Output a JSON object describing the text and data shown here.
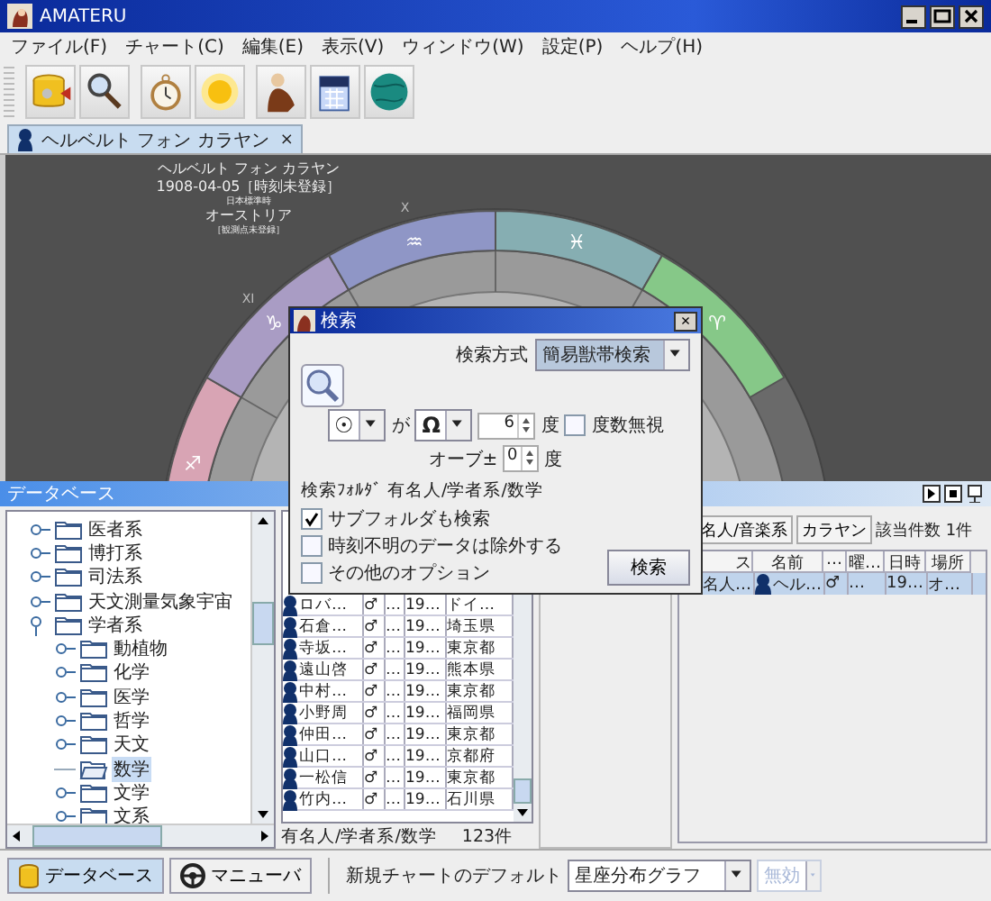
{
  "window": {
    "title": "AMATERU"
  },
  "menu": [
    "ファイル(F)",
    "チャート(C)",
    "編集(E)",
    "表示(V)",
    "ウィンドウ(W)",
    "設定(P)",
    "ヘルプ(H)"
  ],
  "chart_tab": {
    "label": "ヘルベルト フォン カラヤン",
    "close": "×"
  },
  "chart_header": {
    "name": "ヘルベルト フォン カラヤン",
    "date": "1908-04-05［時刻未登録］",
    "timezone": "日本標準時",
    "place": "オーストリア",
    "observation": "［観測点未登録］"
  },
  "wheel_signs": [
    {
      "glyph": "♐",
      "color": "#d8a4b4"
    },
    {
      "glyph": "♑",
      "color": "#a99cc4",
      "house": "XI"
    },
    {
      "glyph": "♒",
      "color": "#8f96c6",
      "house": "X"
    },
    {
      "glyph": "♓",
      "color": "#86aeb2"
    },
    {
      "glyph": "♈",
      "color": "#86c888"
    }
  ],
  "database_panel": {
    "title": "データベース"
  },
  "folder_tree": [
    {
      "label": "医者系",
      "selected": false,
      "expanded": false
    },
    {
      "label": "博打系",
      "selected": false,
      "expanded": false
    },
    {
      "label": "司法系",
      "selected": false,
      "expanded": false
    },
    {
      "label": "天文測量気象宇宙",
      "selected": false,
      "expanded": false
    },
    {
      "label": "学者系",
      "selected": false,
      "expanded": true,
      "children": [
        {
          "label": "動植物",
          "selected": false,
          "expanded": false
        },
        {
          "label": "化学",
          "selected": false,
          "expanded": false
        },
        {
          "label": "医学",
          "selected": false,
          "expanded": false
        },
        {
          "label": "哲学",
          "selected": false,
          "expanded": false
        },
        {
          "label": "天文",
          "selected": false,
          "expanded": false
        },
        {
          "label": "数学",
          "selected": true
        },
        {
          "label": "文学",
          "selected": false,
          "expanded": false
        },
        {
          "label": "文系",
          "selected": false,
          "expanded": false
        }
      ]
    }
  ],
  "person_list": {
    "rows": [
      {
        "name": "ロバ…",
        "sex": "♂",
        "column_3": "…",
        "date": "19…",
        "place": "ドイ…"
      },
      {
        "name": "石倉…",
        "sex": "♂",
        "column_3": "…",
        "date": "19…",
        "place": "埼玉県"
      },
      {
        "name": "寺坂…",
        "sex": "♂",
        "column_3": "…",
        "date": "19…",
        "place": "東京都"
      },
      {
        "name": "遠山啓",
        "sex": "♂",
        "column_3": "…",
        "date": "19…",
        "place": "熊本県"
      },
      {
        "name": "中村…",
        "sex": "♂",
        "column_3": "…",
        "date": "19…",
        "place": "東京都"
      },
      {
        "name": "小野周",
        "sex": "♂",
        "column_3": "…",
        "date": "19…",
        "place": "福岡県"
      },
      {
        "name": "仲田…",
        "sex": "♂",
        "column_3": "…",
        "date": "19…",
        "place": "東京都"
      },
      {
        "name": "山口…",
        "sex": "♂",
        "column_3": "…",
        "date": "19…",
        "place": "京都府"
      },
      {
        "name": "一松信",
        "sex": "♂",
        "column_3": "…",
        "date": "19…",
        "place": "東京都"
      },
      {
        "name": "竹内…",
        "sex": "♂",
        "column_3": "…",
        "date": "19…",
        "place": "石川県"
      }
    ],
    "status_path": "有名人/学者系/数学",
    "status_count": "123件"
  },
  "result_panel": {
    "folder_button": "名人/音楽系",
    "query_button": "カラヤン",
    "count": "該当件数 1件",
    "columns": [
      "ス",
      "名前",
      "…",
      "曜…",
      "日時",
      "場所"
    ],
    "rows": [
      {
        "selected": true,
        "cells": [
          "名人…",
          "ヘル…",
          "♂",
          "…",
          "19…",
          "オ…"
        ]
      }
    ]
  },
  "bottom_bar": {
    "tabs": [
      {
        "label": "データベース",
        "selected": true
      },
      {
        "label": "マニューバ",
        "selected": false
      }
    ],
    "default_label": "新規チャートのデフォルト",
    "default_chart": "星座分布グラフ",
    "extra": {
      "value": "無効",
      "disabled": true
    }
  },
  "search_dialog": {
    "title": "検索",
    "close": "×",
    "method_label": "検索方式",
    "method": "簡易獣帯検索",
    "planet_a": "☉",
    "particle": "が",
    "planet_b": "Ω",
    "degrees": "6",
    "degree_unit": "度",
    "ignore_degrees": {
      "label": "度数無視",
      "checked": false
    },
    "orb_label": "オーブ±",
    "orb": "0",
    "orb_unit": "度",
    "folder_text": "検索ﾌｫﾙﾀﾞ 有名人/学者系/数学",
    "options": [
      {
        "label": "サブフォルダも検索",
        "checked": true
      },
      {
        "label": "時刻不明のデータは除外する",
        "checked": false
      },
      {
        "label": "その他のオプション",
        "checked": false
      }
    ],
    "search_button": "検索"
  }
}
